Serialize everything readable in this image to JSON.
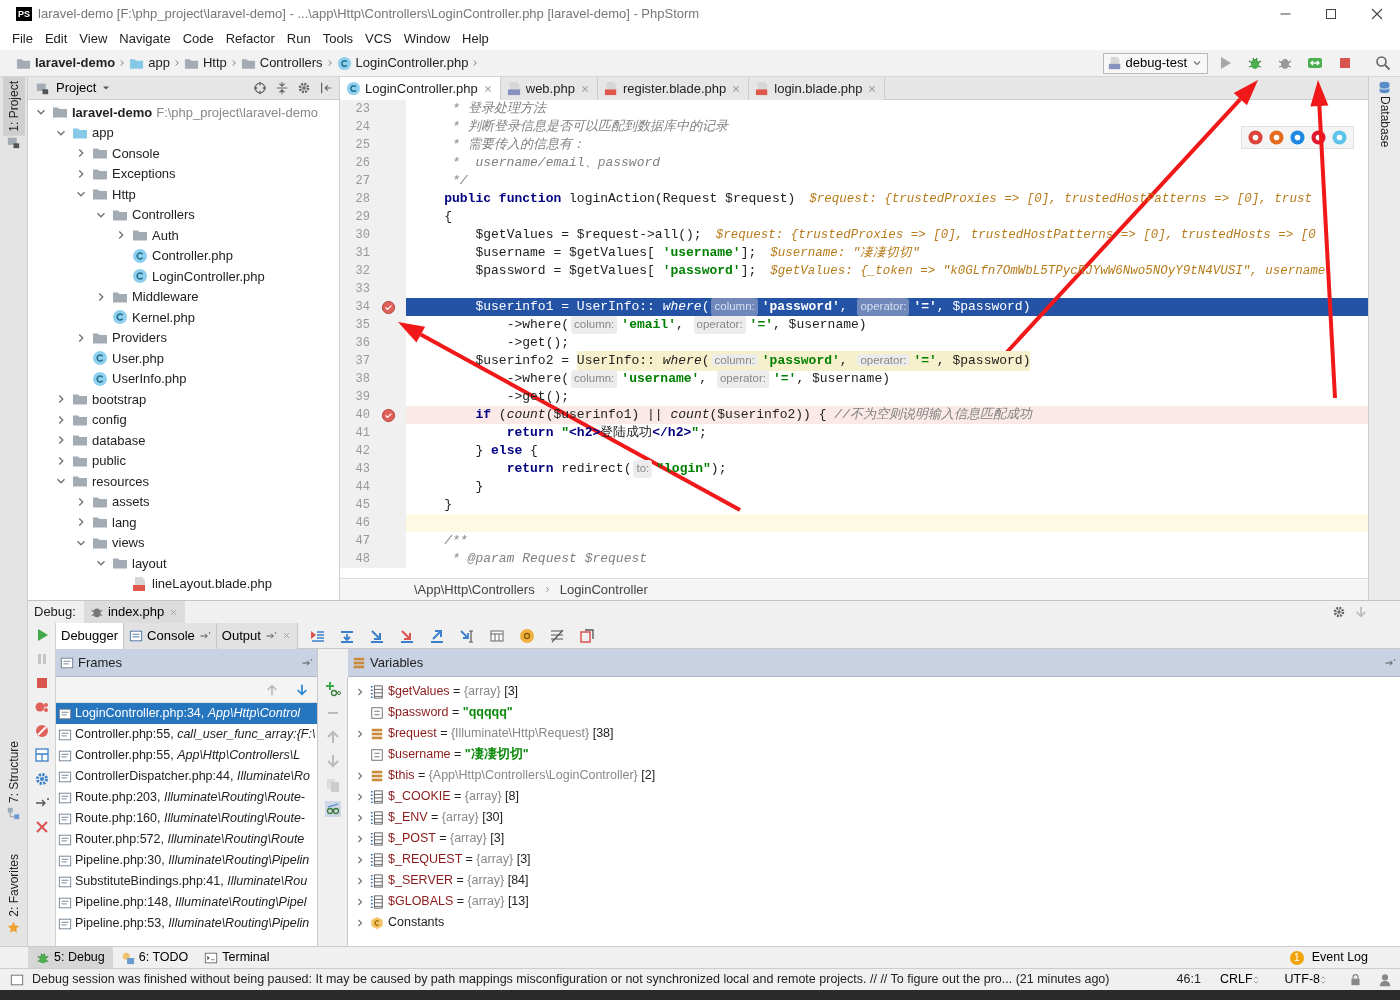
{
  "window": {
    "app_icon": "PS",
    "title": "laravel-demo [F:\\php_project\\laravel-demo] - ...\\app\\Http\\Controllers\\LoginController.php [laravel-demo] - PhpStorm"
  },
  "menu": [
    "File",
    "Edit",
    "View",
    "Navigate",
    "Code",
    "Refactor",
    "Run",
    "Tools",
    "VCS",
    "Window",
    "Help"
  ],
  "breadcrumbs": [
    {
      "label": "laravel-demo",
      "kind": "folder"
    },
    {
      "label": "app",
      "kind": "source-folder"
    },
    {
      "label": "Http",
      "kind": "folder"
    },
    {
      "label": "Controllers",
      "kind": "folder"
    },
    {
      "label": "LoginController.php",
      "kind": "class"
    }
  ],
  "run_config": {
    "label": "debug-test"
  },
  "side_tabs": {
    "left": [
      {
        "label": "1: Project",
        "selected": true
      },
      {
        "label": "7: Structure",
        "selected": false
      },
      {
        "label": "2: Favorites",
        "selected": false
      }
    ],
    "right": [
      {
        "label": "Database"
      }
    ]
  },
  "project": {
    "title": "Project",
    "tree": [
      {
        "label": "laravel-demo",
        "path": "F:\\php_project\\laravel-demo",
        "kind": "folder",
        "expanded": true,
        "children": [
          {
            "label": "app",
            "kind": "source-folder",
            "expanded": true,
            "children": [
              {
                "label": "Console",
                "kind": "folder",
                "expanded": false
              },
              {
                "label": "Exceptions",
                "kind": "folder",
                "expanded": false
              },
              {
                "label": "Http",
                "kind": "folder",
                "expanded": true,
                "children": [
                  {
                    "label": "Controllers",
                    "kind": "folder",
                    "expanded": true,
                    "children": [
                      {
                        "label": "Auth",
                        "kind": "folder",
                        "expanded": false
                      },
                      {
                        "label": "Controller.php",
                        "kind": "class"
                      },
                      {
                        "label": "LoginController.php",
                        "kind": "class"
                      }
                    ]
                  },
                  {
                    "label": "Middleware",
                    "kind": "folder",
                    "expanded": false
                  },
                  {
                    "label": "Kernel.php",
                    "kind": "class"
                  }
                ]
              },
              {
                "label": "Providers",
                "kind": "folder",
                "expanded": false
              },
              {
                "label": "User.php",
                "kind": "class"
              },
              {
                "label": "UserInfo.php",
                "kind": "class"
              }
            ]
          },
          {
            "label": "bootstrap",
            "kind": "folder",
            "expanded": false
          },
          {
            "label": "config",
            "kind": "folder",
            "expanded": false
          },
          {
            "label": "database",
            "kind": "folder",
            "expanded": false
          },
          {
            "label": "public",
            "kind": "folder",
            "expanded": false
          },
          {
            "label": "resources",
            "kind": "folder",
            "expanded": true,
            "children": [
              {
                "label": "assets",
                "kind": "folder",
                "expanded": false
              },
              {
                "label": "lang",
                "kind": "folder",
                "expanded": false
              },
              {
                "label": "views",
                "kind": "folder",
                "expanded": true,
                "children": [
                  {
                    "label": "layout",
                    "kind": "folder",
                    "expanded": true,
                    "children": [
                      {
                        "label": "lineLayout.blade.php",
                        "kind": "blade"
                      }
                    ]
                  }
                ]
              }
            ]
          }
        ]
      }
    ]
  },
  "editor_tabs": [
    {
      "label": "LoginController.php",
      "kind": "class",
      "selected": true
    },
    {
      "label": "web.php",
      "kind": "php",
      "selected": false
    },
    {
      "label": "register.blade.php",
      "kind": "blade",
      "selected": false
    },
    {
      "label": "login.blade.php",
      "kind": "blade",
      "selected": false
    }
  ],
  "browser_icons": [
    {
      "color": "#db4437"
    },
    {
      "color": "#e66a1c"
    },
    {
      "color": "#1e88e5"
    },
    {
      "color": "#e0182d"
    },
    {
      "color": "#5cc4e8"
    }
  ],
  "code": {
    "lines": [
      {
        "no": "23",
        "kind": "plain",
        "breakpoint": false,
        "tokens": [
          {
            "kind": "comment",
            "text": "     * 登录处理方法"
          }
        ]
      },
      {
        "no": "24",
        "kind": "plain",
        "breakpoint": false,
        "tokens": [
          {
            "kind": "comment",
            "text": "     * 判断登录信息是否可以匹配到数据库中的记录"
          }
        ]
      },
      {
        "no": "25",
        "kind": "plain",
        "breakpoint": false,
        "tokens": [
          {
            "kind": "comment",
            "text": "     * 需要传入的信息有："
          }
        ]
      },
      {
        "no": "26",
        "kind": "plain",
        "breakpoint": false,
        "tokens": [
          {
            "kind": "comment",
            "text": "     *  username/email、password"
          }
        ]
      },
      {
        "no": "27",
        "kind": "plain",
        "breakpoint": false,
        "tokens": [
          {
            "kind": "comment",
            "text": "     */"
          }
        ]
      },
      {
        "no": "28",
        "kind": "plain",
        "breakpoint": false,
        "tokens": [
          {
            "kind": "keyword",
            "text": "    public function"
          },
          {
            "kind": "plain",
            "text": " loginAction(Request $request)"
          }
        ],
        "inline_value": "$request: {trustedProxies => [0], trustedHostPatterns => [0], trust"
      },
      {
        "no": "29",
        "kind": "plain",
        "breakpoint": false,
        "tokens": [
          {
            "kind": "plain",
            "text": "    {"
          }
        ]
      },
      {
        "no": "30",
        "kind": "plain",
        "breakpoint": false,
        "tokens": [
          {
            "kind": "plain",
            "text": "        $getValues = $request->all();"
          }
        ],
        "inline_value": "$request: {trustedProxies => [0], trustedHostPatterns => [0], trustedHosts => [0"
      },
      {
        "no": "31",
        "kind": "plain",
        "breakpoint": false,
        "tokens": [
          {
            "kind": "plain",
            "text": "        $username = $getValues["
          },
          {
            "kind": "string",
            "text": "'username'"
          },
          {
            "kind": "plain",
            "text": "];"
          }
        ],
        "inline_value": "$username: \"凄凄切切\""
      },
      {
        "no": "32",
        "kind": "plain",
        "breakpoint": false,
        "tokens": [
          {
            "kind": "plain",
            "text": "        $password = $getValues["
          },
          {
            "kind": "string",
            "text": "'password'"
          },
          {
            "kind": "plain",
            "text": "];"
          }
        ],
        "inline_value": "$getValues: {_token => \"k0GLfn7OmWbL5TPycRJYwW6Nwo5NOyY9tN4VUSI\", username"
      },
      {
        "no": "33",
        "kind": "plain",
        "breakpoint": false
      },
      {
        "no": "34",
        "kind": "execution",
        "breakpoint": true,
        "tokens": [
          {
            "kind": "plain",
            "text": "        $userinfo1 = UserInfo::"
          },
          {
            "kind": "call",
            "text": "where"
          },
          {
            "kind": "plain",
            "text": "("
          },
          {
            "kind": "hint",
            "text": "column:"
          },
          {
            "kind": "string",
            "text": "'password'"
          },
          {
            "kind": "plain",
            "text": ","
          },
          {
            "kind": "hint",
            "text": "operator:"
          },
          {
            "kind": "string",
            "text": "'='"
          },
          {
            "kind": "plain",
            "text": ", $password)"
          }
        ]
      },
      {
        "no": "35",
        "kind": "plain",
        "breakpoint": false,
        "tokens": [
          {
            "kind": "plain",
            "text": "            ->where("
          },
          {
            "kind": "hint",
            "text": "column:"
          },
          {
            "kind": "string",
            "text": "'email'"
          },
          {
            "kind": "plain",
            "text": ","
          },
          {
            "kind": "hint",
            "text": "operator:"
          },
          {
            "kind": "string",
            "text": "'='"
          },
          {
            "kind": "plain",
            "text": ", $username)"
          }
        ]
      },
      {
        "no": "36",
        "kind": "plain",
        "breakpoint": false,
        "tokens": [
          {
            "kind": "plain",
            "text": "            ->get();"
          }
        ]
      },
      {
        "no": "37",
        "kind": "plain",
        "breakpoint": false,
        "tokens": [
          {
            "kind": "plain",
            "text": "        $userinfo2 ="
          },
          {
            "kind": "usage",
            "tokens": [
              {
                "kind": "plain",
                "text": "UserInfo::"
              },
              {
                "kind": "call",
                "text": "where"
              },
              {
                "kind": "plain",
                "text": "("
              },
              {
                "kind": "hint",
                "text": "column:"
              },
              {
                "kind": "string",
                "text": "'password'"
              },
              {
                "kind": "plain",
                "text": ","
              },
              {
                "kind": "hint",
                "text": "operator:"
              },
              {
                "kind": "string",
                "text": "'='"
              },
              {
                "kind": "plain",
                "text": ", $password)"
              }
            ]
          }
        ]
      },
      {
        "no": "38",
        "kind": "plain",
        "breakpoint": false,
        "tokens": [
          {
            "kind": "plain",
            "text": "            ->where("
          },
          {
            "kind": "hint",
            "text": "column:"
          },
          {
            "kind": "string",
            "text": "'username'"
          },
          {
            "kind": "plain",
            "text": ","
          },
          {
            "kind": "hint",
            "text": "operator:"
          },
          {
            "kind": "string",
            "text": "'='"
          },
          {
            "kind": "plain",
            "text": ", $username)"
          }
        ]
      },
      {
        "no": "39",
        "kind": "plain",
        "breakpoint": false,
        "tokens": [
          {
            "kind": "plain",
            "text": "            ->get();"
          }
        ]
      },
      {
        "no": "40",
        "kind": "breakpoint",
        "breakpoint": true,
        "tokens": [
          {
            "kind": "keyword",
            "text": "        if"
          },
          {
            "kind": "plain",
            "text": " ("
          },
          {
            "kind": "call",
            "text": "count"
          },
          {
            "kind": "plain",
            "text": "($userinfo1) ||"
          },
          {
            "kind": "call",
            "text": "count"
          },
          {
            "kind": "plain",
            "text": "($userinfo2)) {"
          },
          {
            "kind": "comment",
            "text": "//不为空则说明输入信息匹配成功"
          }
        ]
      },
      {
        "no": "41",
        "kind": "plain",
        "breakpoint": false,
        "tokens": [
          {
            "kind": "keyword",
            "text": "            return"
          },
          {
            "kind": "string",
            "text": "\""
          },
          {
            "kind": "tag",
            "text": "<h2>"
          },
          {
            "kind": "plain",
            "text": "登陆成功"
          },
          {
            "kind": "tag",
            "text": "</h2>"
          },
          {
            "kind": "string",
            "text": "\""
          },
          {
            "kind": "plain",
            "text": ";"
          }
        ]
      },
      {
        "no": "42",
        "kind": "plain",
        "breakpoint": false,
        "tokens": [
          {
            "kind": "plain",
            "text": "        }"
          },
          {
            "kind": "keyword",
            "text": "else"
          },
          {
            "kind": "plain",
            "text": " {"
          }
        ]
      },
      {
        "no": "43",
        "kind": "plain",
        "breakpoint": false,
        "tokens": [
          {
            "kind": "keyword",
            "text": "            return"
          },
          {
            "kind": "plain",
            "text": " redirect("
          },
          {
            "kind": "hint",
            "text": "to:"
          },
          {
            "kind": "string",
            "text": "\"login\""
          },
          {
            "kind": "plain",
            "text": ");"
          }
        ]
      },
      {
        "no": "44",
        "kind": "plain",
        "breakpoint": false,
        "tokens": [
          {
            "kind": "plain",
            "text": "        }"
          }
        ]
      },
      {
        "no": "45",
        "kind": "plain",
        "breakpoint": false,
        "tokens": [
          {
            "kind": "plain",
            "text": "    }"
          }
        ]
      },
      {
        "no": "46",
        "kind": "caret",
        "breakpoint": false
      },
      {
        "no": "47",
        "kind": "plain",
        "breakpoint": false,
        "tokens": [
          {
            "kind": "comment",
            "text": "    /**"
          }
        ]
      },
      {
        "no": "48",
        "kind": "plain",
        "breakpoint": false,
        "tokens": [
          {
            "kind": "comment",
            "text": "     * @param Request $request"
          }
        ]
      }
    ],
    "breadcrumb": [
      "\\App\\Http\\Controllers",
      "LoginController"
    ]
  },
  "debug": {
    "label": "Debug:",
    "session_tab": "index.php",
    "tabs": [
      {
        "label": "Debugger",
        "selected": true
      },
      {
        "label": "Console",
        "selected": false
      },
      {
        "label": "Output",
        "selected": false
      }
    ],
    "frames": {
      "title": "Frames",
      "items": [
        {
          "label": "LoginController.php:34, *App\\Http\\Control*",
          "selected": true
        },
        {
          "label": "Controller.php:55, *call_user_func_array:{F:\\*",
          "selected": false
        },
        {
          "label": "Controller.php:55, *App\\Http\\Controllers\\L*",
          "selected": false
        },
        {
          "label": "ControllerDispatcher.php:44, *Illuminate\\Ro*",
          "selected": false
        },
        {
          "label": "Route.php:203, *Illuminate\\Routing\\Route-*",
          "selected": false
        },
        {
          "label": "Route.php:160, *Illuminate\\Routing\\Route-*",
          "selected": false
        },
        {
          "label": "Router.php:572, *Illuminate\\Routing\\Route*",
          "selected": false
        },
        {
          "label": "Pipeline.php:30, *Illuminate\\Routing\\Pipelin*",
          "selected": false
        },
        {
          "label": "SubstituteBindings.php:41, *Illuminate\\Rou*",
          "selected": false
        },
        {
          "label": "Pipeline.php:148, *Illuminate\\Routing\\Pipel*",
          "selected": false
        },
        {
          "label": "Pipeline.php:53, *Illuminate\\Routing\\Pipelin*",
          "selected": false
        }
      ]
    },
    "variables": {
      "title": "Variables",
      "items": [
        {
          "kind": "array",
          "name": "$getValues",
          "eq": "=",
          "type": "{array}",
          "size": "[3]",
          "expanded": false
        },
        {
          "kind": "string",
          "name": "$password",
          "eq": "=",
          "value": "\"qqqqq\""
        },
        {
          "kind": "object",
          "name": "$request",
          "eq": "=",
          "type": "{Illuminate\\Http\\Request}",
          "size": "[38]",
          "expanded": false
        },
        {
          "kind": "string",
          "name": "$username",
          "eq": "=",
          "value": "\"凄凄切切\""
        },
        {
          "kind": "object",
          "name": "$this",
          "eq": "=",
          "type": "{App\\Http\\Controllers\\LoginController}",
          "size": "[2]",
          "expanded": false
        },
        {
          "kind": "array",
          "name": "$_COOKIE",
          "eq": "=",
          "type": "{array}",
          "size": "[8]",
          "expanded": false
        },
        {
          "kind": "array",
          "name": "$_ENV",
          "eq": "=",
          "type": "{array}",
          "size": "[30]",
          "expanded": false
        },
        {
          "kind": "array",
          "name": "$_POST",
          "eq": "=",
          "type": "{array}",
          "size": "[3]",
          "expanded": false
        },
        {
          "kind": "array",
          "name": "$_REQUEST",
          "eq": "=",
          "type": "{array}",
          "size": "[3]",
          "expanded": false
        },
        {
          "kind": "array",
          "name": "$_SERVER",
          "eq": "=",
          "type": "{array}",
          "size": "[84]",
          "expanded": false
        },
        {
          "kind": "array",
          "name": "$GLOBALS",
          "eq": "=",
          "type": "{array}",
          "size": "[13]",
          "expanded": false
        },
        {
          "kind": "constants",
          "name": "Constants",
          "expanded": false
        }
      ]
    }
  },
  "tool_tabs": [
    {
      "label": "5: Debug",
      "kind": "bug",
      "selected": true
    },
    {
      "label": "6: TODO",
      "kind": "todo",
      "selected": false
    },
    {
      "label": "Terminal",
      "kind": "terminal",
      "selected": false
    }
  ],
  "event_log": {
    "badge": "1",
    "label": "Event Log"
  },
  "status_bar": {
    "message": "Debug session was finished without being paused: It may be caused by path mappings misconfiguration or not synchronized local and remote projects. // // To figure out the pro... (21 minutes ago)",
    "position": "46:1",
    "line_separator": "CRLF",
    "encoding": "UTF-8"
  },
  "annotations": [
    {
      "kind": "arrow"
    },
    {
      "kind": "arrow"
    },
    {
      "kind": "arrow"
    }
  ]
}
